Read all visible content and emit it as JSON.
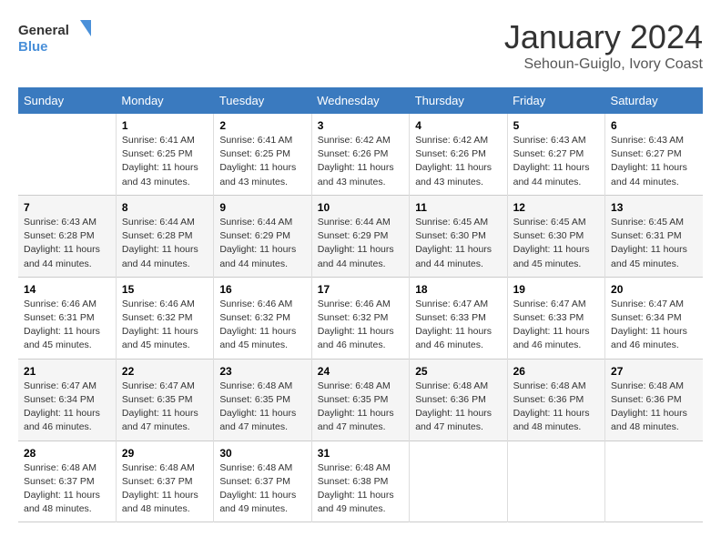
{
  "header": {
    "logo_line1": "General",
    "logo_line2": "Blue",
    "month": "January 2024",
    "location": "Sehoun-Guiglo, Ivory Coast"
  },
  "days_of_week": [
    "Sunday",
    "Monday",
    "Tuesday",
    "Wednesday",
    "Thursday",
    "Friday",
    "Saturday"
  ],
  "weeks": [
    [
      {
        "day": "",
        "text": ""
      },
      {
        "day": "1",
        "text": "Sunrise: 6:41 AM\nSunset: 6:25 PM\nDaylight: 11 hours\nand 43 minutes."
      },
      {
        "day": "2",
        "text": "Sunrise: 6:41 AM\nSunset: 6:25 PM\nDaylight: 11 hours\nand 43 minutes."
      },
      {
        "day": "3",
        "text": "Sunrise: 6:42 AM\nSunset: 6:26 PM\nDaylight: 11 hours\nand 43 minutes."
      },
      {
        "day": "4",
        "text": "Sunrise: 6:42 AM\nSunset: 6:26 PM\nDaylight: 11 hours\nand 43 minutes."
      },
      {
        "day": "5",
        "text": "Sunrise: 6:43 AM\nSunset: 6:27 PM\nDaylight: 11 hours\nand 44 minutes."
      },
      {
        "day": "6",
        "text": "Sunrise: 6:43 AM\nSunset: 6:27 PM\nDaylight: 11 hours\nand 44 minutes."
      }
    ],
    [
      {
        "day": "7",
        "text": "Sunrise: 6:43 AM\nSunset: 6:28 PM\nDaylight: 11 hours\nand 44 minutes."
      },
      {
        "day": "8",
        "text": "Sunrise: 6:44 AM\nSunset: 6:28 PM\nDaylight: 11 hours\nand 44 minutes."
      },
      {
        "day": "9",
        "text": "Sunrise: 6:44 AM\nSunset: 6:29 PM\nDaylight: 11 hours\nand 44 minutes."
      },
      {
        "day": "10",
        "text": "Sunrise: 6:44 AM\nSunset: 6:29 PM\nDaylight: 11 hours\nand 44 minutes."
      },
      {
        "day": "11",
        "text": "Sunrise: 6:45 AM\nSunset: 6:30 PM\nDaylight: 11 hours\nand 44 minutes."
      },
      {
        "day": "12",
        "text": "Sunrise: 6:45 AM\nSunset: 6:30 PM\nDaylight: 11 hours\nand 45 minutes."
      },
      {
        "day": "13",
        "text": "Sunrise: 6:45 AM\nSunset: 6:31 PM\nDaylight: 11 hours\nand 45 minutes."
      }
    ],
    [
      {
        "day": "14",
        "text": "Sunrise: 6:46 AM\nSunset: 6:31 PM\nDaylight: 11 hours\nand 45 minutes."
      },
      {
        "day": "15",
        "text": "Sunrise: 6:46 AM\nSunset: 6:32 PM\nDaylight: 11 hours\nand 45 minutes."
      },
      {
        "day": "16",
        "text": "Sunrise: 6:46 AM\nSunset: 6:32 PM\nDaylight: 11 hours\nand 45 minutes."
      },
      {
        "day": "17",
        "text": "Sunrise: 6:46 AM\nSunset: 6:32 PM\nDaylight: 11 hours\nand 46 minutes."
      },
      {
        "day": "18",
        "text": "Sunrise: 6:47 AM\nSunset: 6:33 PM\nDaylight: 11 hours\nand 46 minutes."
      },
      {
        "day": "19",
        "text": "Sunrise: 6:47 AM\nSunset: 6:33 PM\nDaylight: 11 hours\nand 46 minutes."
      },
      {
        "day": "20",
        "text": "Sunrise: 6:47 AM\nSunset: 6:34 PM\nDaylight: 11 hours\nand 46 minutes."
      }
    ],
    [
      {
        "day": "21",
        "text": "Sunrise: 6:47 AM\nSunset: 6:34 PM\nDaylight: 11 hours\nand 46 minutes."
      },
      {
        "day": "22",
        "text": "Sunrise: 6:47 AM\nSunset: 6:35 PM\nDaylight: 11 hours\nand 47 minutes."
      },
      {
        "day": "23",
        "text": "Sunrise: 6:48 AM\nSunset: 6:35 PM\nDaylight: 11 hours\nand 47 minutes."
      },
      {
        "day": "24",
        "text": "Sunrise: 6:48 AM\nSunset: 6:35 PM\nDaylight: 11 hours\nand 47 minutes."
      },
      {
        "day": "25",
        "text": "Sunrise: 6:48 AM\nSunset: 6:36 PM\nDaylight: 11 hours\nand 47 minutes."
      },
      {
        "day": "26",
        "text": "Sunrise: 6:48 AM\nSunset: 6:36 PM\nDaylight: 11 hours\nand 48 minutes."
      },
      {
        "day": "27",
        "text": "Sunrise: 6:48 AM\nSunset: 6:36 PM\nDaylight: 11 hours\nand 48 minutes."
      }
    ],
    [
      {
        "day": "28",
        "text": "Sunrise: 6:48 AM\nSunset: 6:37 PM\nDaylight: 11 hours\nand 48 minutes."
      },
      {
        "day": "29",
        "text": "Sunrise: 6:48 AM\nSunset: 6:37 PM\nDaylight: 11 hours\nand 48 minutes."
      },
      {
        "day": "30",
        "text": "Sunrise: 6:48 AM\nSunset: 6:37 PM\nDaylight: 11 hours\nand 49 minutes."
      },
      {
        "day": "31",
        "text": "Sunrise: 6:48 AM\nSunset: 6:38 PM\nDaylight: 11 hours\nand 49 minutes."
      },
      {
        "day": "",
        "text": ""
      },
      {
        "day": "",
        "text": ""
      },
      {
        "day": "",
        "text": ""
      }
    ]
  ]
}
